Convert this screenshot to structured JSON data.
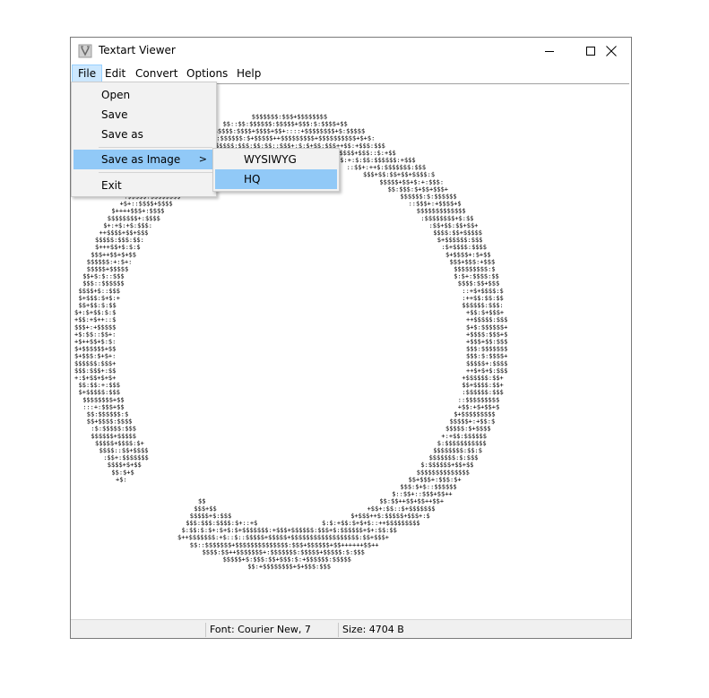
{
  "window": {
    "title": "Textart Viewer",
    "icon": "textart-app-icon",
    "controls": [
      "minimize-icon",
      "maximize-icon",
      "close-icon"
    ]
  },
  "menubar": {
    "items": [
      "File",
      "Edit",
      "Convert",
      "Options",
      "Help"
    ],
    "active": "File"
  },
  "file_menu": {
    "items": [
      "Open",
      "Save",
      "Save as",
      "Save as Image",
      "Exit"
    ],
    "highlighted": "Save as Image",
    "submenu_arrow": ">"
  },
  "image_submenu": {
    "items": [
      "WYSIWYG",
      "HQ"
    ],
    "highlighted": "HQ"
  },
  "content": {
    "art_font_color": "#000000"
  },
  "status": {
    "left": "",
    "font": "Font: Courier New, 7",
    "size": "Size: 4704 B"
  },
  "colors": {
    "menu_highlight": "#91c9f7",
    "menubar_active": "#cce8ff"
  }
}
